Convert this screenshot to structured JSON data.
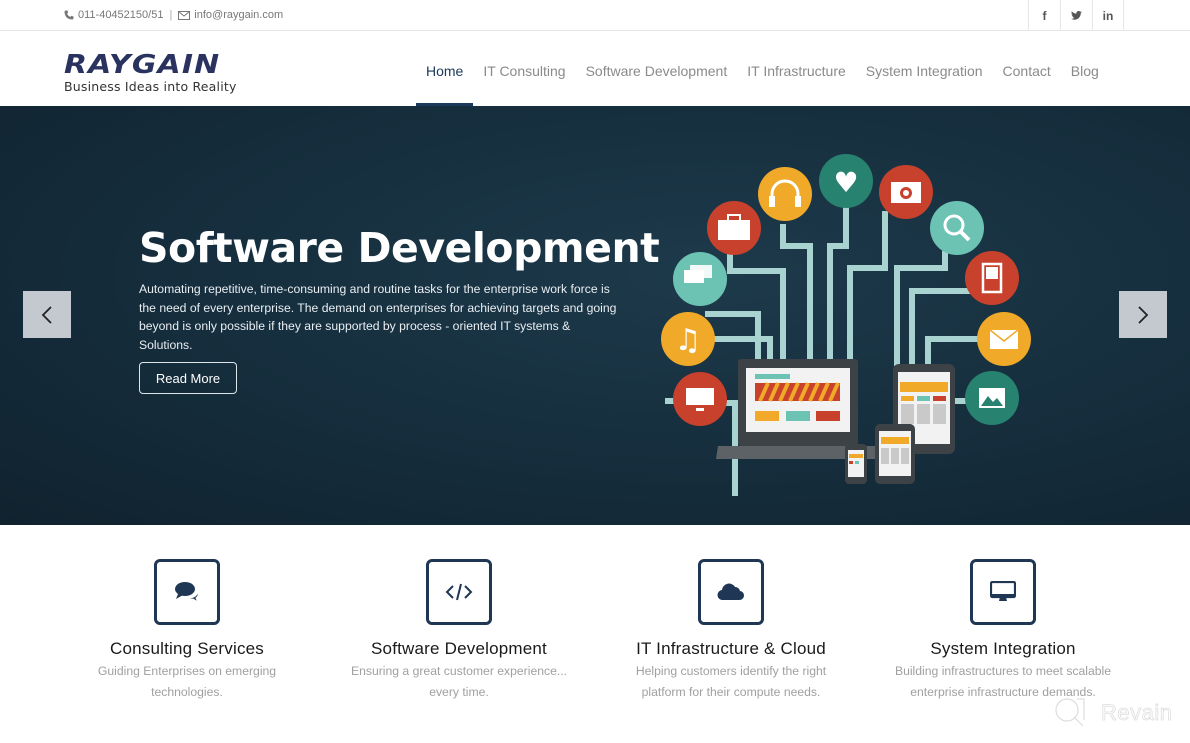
{
  "topbar": {
    "phone": "011-40452150/51",
    "separator": "|",
    "email": "info@raygain.com",
    "social": [
      {
        "label": "f",
        "icon": "facebook-icon"
      },
      {
        "label": "t",
        "icon": "twitter-icon"
      },
      {
        "label": "in",
        "icon": "linkedin-icon"
      }
    ]
  },
  "header": {
    "logo_text": "RAYGAIN",
    "tagline": "Business Ideas into Reality",
    "nav": [
      {
        "label": "Home",
        "active": true
      },
      {
        "label": "IT Consulting"
      },
      {
        "label": "Software Development"
      },
      {
        "label": "IT Infrastructure"
      },
      {
        "label": "System Integration"
      },
      {
        "label": "Contact"
      },
      {
        "label": "Blog"
      }
    ]
  },
  "hero": {
    "title": "Software Development",
    "text": "Automating repetitive, time-consuming and routine tasks for the enterprise work force is the need of every enterprise. The demand on enterprises for achieving targets and going beyond is only possible if they are supported by process - oriented IT systems & Solutions.",
    "button": "Read More",
    "prev_icon": "chevron-left-icon",
    "next_icon": "chevron-right-icon",
    "colors": {
      "orange": "#f0a928",
      "red": "#c8412c",
      "teal": "#27826f",
      "mint": "#6cc3b4",
      "line": "#a9d3d0"
    }
  },
  "services": [
    {
      "title": "Consulting Services",
      "desc_line1": "Guiding Enterprises on emerging",
      "desc_line2": "technologies.",
      "icon": "comments-icon"
    },
    {
      "title": "Software Development",
      "desc_line1": "Ensuring a great customer experience...",
      "desc_line2": "every time.",
      "icon": "code-icon"
    },
    {
      "title": "IT Infrastructure & Cloud",
      "desc_line1": "Helping customers identify the right",
      "desc_line2": "platform for their compute needs.",
      "icon": "cloud-icon"
    },
    {
      "title": "System Integration",
      "desc_line1": "Building infrastructures to meet scalable",
      "desc_line2": "enterprise infrastructure demands.",
      "icon": "desktop-icon"
    }
  ],
  "watermark": "Revain",
  "brand_color": "#1f3655"
}
